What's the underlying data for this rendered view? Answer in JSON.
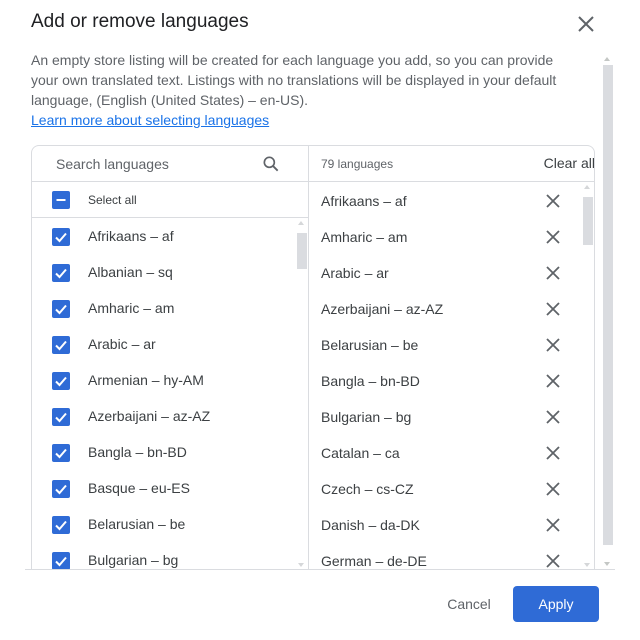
{
  "dialog": {
    "title": "Add or remove languages",
    "close_icon": "close-icon",
    "description": "An empty store listing will be created for each language you add, so you can provide your own translated text. Listings with no translations will be displayed in your default language, (English (United States) – en-US).",
    "learn_more_link": "Learn more about selecting languages"
  },
  "available": {
    "search_placeholder": "Search languages",
    "search_value": "",
    "search_icon": "search-icon",
    "select_all_label": "Select all",
    "select_all_state": "indeterminate",
    "items": [
      {
        "label": "Afrikaans – af",
        "checked": true
      },
      {
        "label": "Albanian – sq",
        "checked": true
      },
      {
        "label": "Amharic – am",
        "checked": true
      },
      {
        "label": "Arabic – ar",
        "checked": true
      },
      {
        "label": "Armenian – hy-AM",
        "checked": true
      },
      {
        "label": "Azerbaijani – az-AZ",
        "checked": true
      },
      {
        "label": "Bangla – bn-BD",
        "checked": true
      },
      {
        "label": "Basque – eu-ES",
        "checked": true
      },
      {
        "label": "Belarusian – be",
        "checked": true
      },
      {
        "label": "Bulgarian – bg",
        "checked": true
      }
    ]
  },
  "selected": {
    "count_label": "79 languages",
    "clear_all_label": "Clear all",
    "remove_icon": "close-icon",
    "items": [
      {
        "label": "Afrikaans – af"
      },
      {
        "label": "Amharic – am"
      },
      {
        "label": "Arabic – ar"
      },
      {
        "label": "Azerbaijani – az-AZ"
      },
      {
        "label": "Belarusian – be"
      },
      {
        "label": "Bangla – bn-BD"
      },
      {
        "label": "Bulgarian – bg"
      },
      {
        "label": "Catalan – ca"
      },
      {
        "label": "Czech – cs-CZ"
      },
      {
        "label": "Danish – da-DK"
      },
      {
        "label": "German – de-DE"
      }
    ]
  },
  "footer": {
    "cancel_label": "Cancel",
    "apply_label": "Apply"
  },
  "colors": {
    "accent": "#2f6bd6",
    "link": "#1a73e8",
    "text": "#3c4043",
    "border": "#dadce0"
  }
}
